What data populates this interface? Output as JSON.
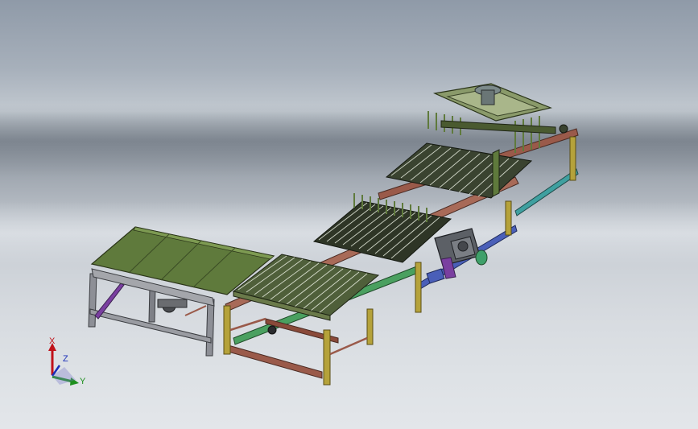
{
  "viewport": {
    "background_top": "#8f9aa8",
    "background_bottom": "#e3e6ea"
  },
  "model": {
    "frame_color": "#9a5a4a",
    "conveyor_color": "#5f7a3c",
    "roller_color": "#2a2f26",
    "accent_colors": [
      "#7a3fa0",
      "#3fa06a",
      "#3f5fbf",
      "#b5a23a"
    ]
  },
  "triad": {
    "x_label": "X",
    "y_label": "Y",
    "z_label": "Z",
    "x_color": "#c0121a",
    "y_color": "#1d8f1d",
    "z_color": "#1a2fb8"
  }
}
